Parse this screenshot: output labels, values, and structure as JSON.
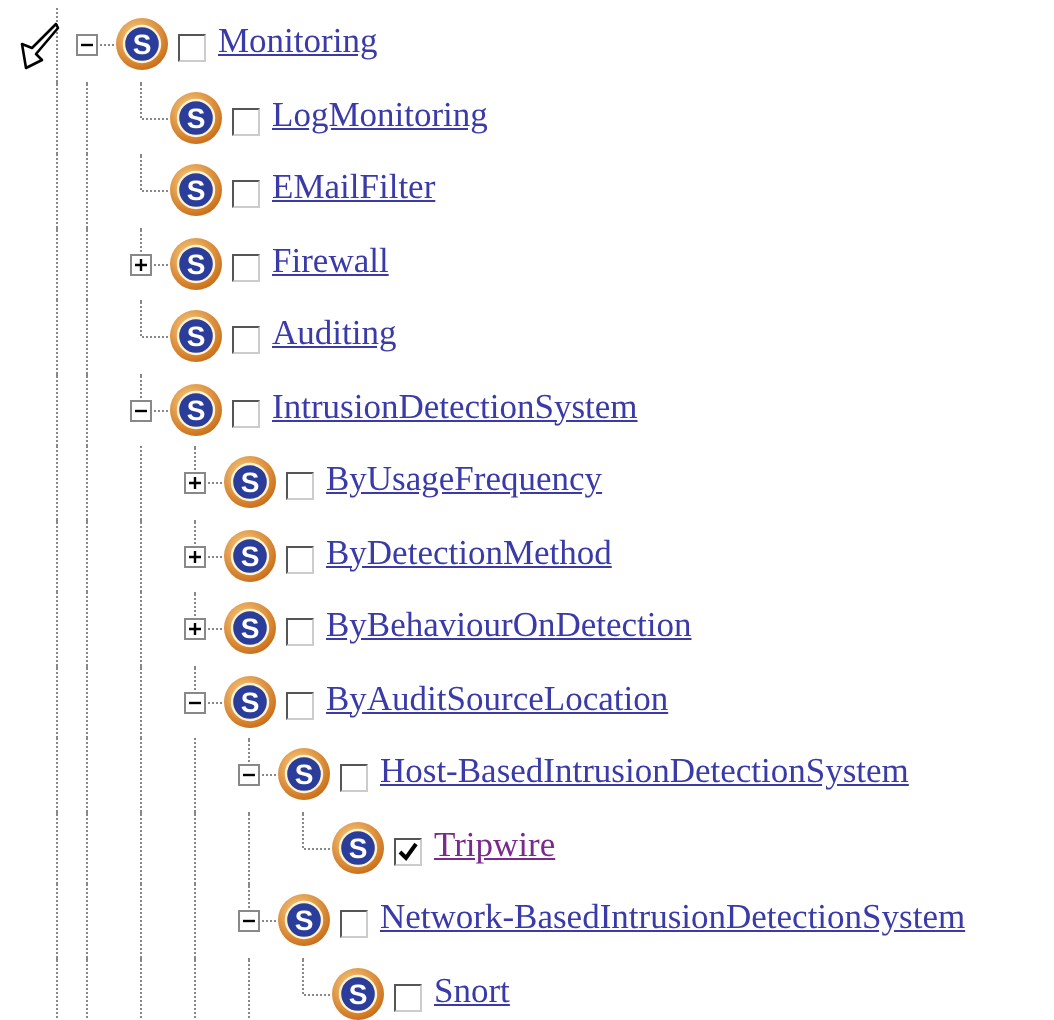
{
  "tree": [
    {
      "label": "Monitoring",
      "icon": "S",
      "checked": false,
      "visited": false,
      "expanded": true,
      "children": [
        {
          "label": "LogMonitoring",
          "icon": "S",
          "checked": false,
          "visited": false
        },
        {
          "label": "EMailFilter",
          "icon": "S",
          "checked": false,
          "visited": false
        },
        {
          "label": "Firewall",
          "icon": "S",
          "checked": false,
          "visited": false,
          "expanded": false
        },
        {
          "label": "Auditing",
          "icon": "S",
          "checked": false,
          "visited": false
        },
        {
          "label": "IntrusionDetectionSystem",
          "icon": "S",
          "checked": false,
          "visited": false,
          "expanded": true,
          "children": [
            {
              "label": "ByUsageFrequency",
              "icon": "S",
              "checked": false,
              "visited": false,
              "expanded": false
            },
            {
              "label": "ByDetectionMethod",
              "icon": "S",
              "checked": false,
              "visited": false,
              "expanded": false
            },
            {
              "label": "ByBehaviourOnDetection",
              "icon": "S",
              "checked": false,
              "visited": false,
              "expanded": false
            },
            {
              "label": "ByAuditSourceLocation",
              "icon": "S",
              "checked": false,
              "visited": false,
              "expanded": true,
              "children": [
                {
                  "label": "Host-BasedIntrusionDetectionSystem",
                  "icon": "S",
                  "checked": false,
                  "visited": false,
                  "expanded": true,
                  "children": [
                    {
                      "label": "Tripwire",
                      "icon": "S",
                      "checked": true,
                      "visited": true
                    }
                  ]
                },
                {
                  "label": "Network-BasedIntrusionDetectionSystem",
                  "icon": "S",
                  "checked": false,
                  "visited": false,
                  "expanded": true,
                  "children": [
                    {
                      "label": "Snort",
                      "icon": "S",
                      "checked": false,
                      "visited": false
                    }
                  ]
                }
              ]
            }
          ]
        }
      ]
    }
  ]
}
